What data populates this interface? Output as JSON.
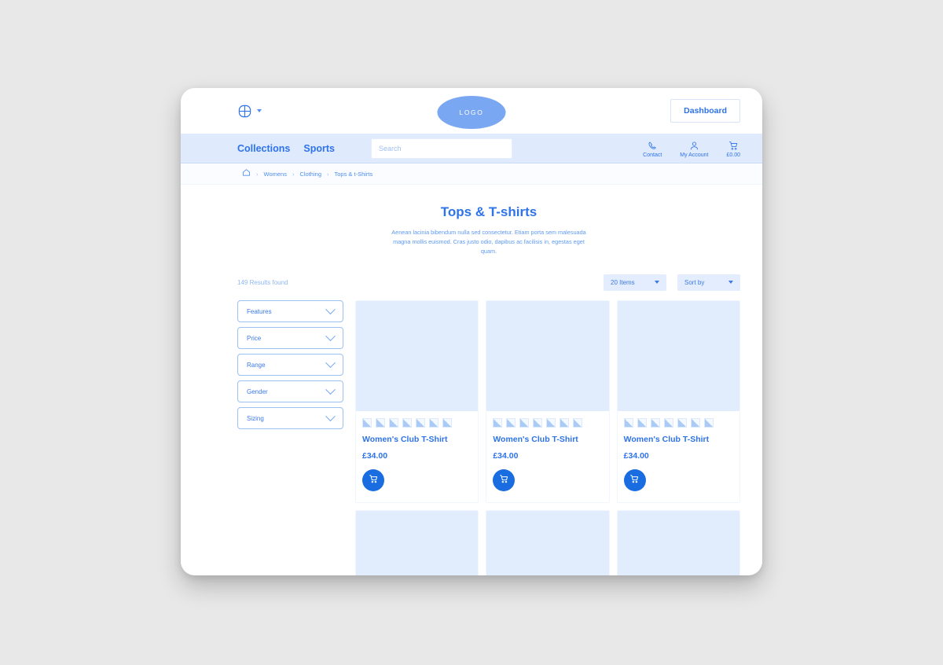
{
  "header": {
    "language_icon": "globe-icon",
    "language_caret": "caret-down-icon",
    "logo_text": "LOGO",
    "dashboard_label": "Dashboard"
  },
  "nav": {
    "links": [
      {
        "label": "Collections"
      },
      {
        "label": "Sports"
      }
    ],
    "search": {
      "placeholder": "Search",
      "value": ""
    },
    "actions": [
      {
        "icon": "phone-icon",
        "label": "Contact"
      },
      {
        "icon": "user-icon",
        "label": "My Account"
      },
      {
        "icon": "cart-icon",
        "label": "£0.00"
      }
    ]
  },
  "breadcrumb": {
    "home_icon": "home-icon",
    "separator": "›",
    "items": [
      {
        "label": "Womens"
      },
      {
        "label": "Clothing"
      },
      {
        "label": "Tops & t-Shirts"
      }
    ]
  },
  "page": {
    "title": "Tops & T-shirts",
    "description": "Aenean lacinia bibendum nulla sed consectetur. Etiam porta sem malesuada magna mollis euismod. Cras justo odio, dapibus ac facilisis in, egestas eget quam."
  },
  "toolbar": {
    "results_count": "149 Results found",
    "items_per_page": "20 Items",
    "sort_by": "Sort by"
  },
  "filters": [
    {
      "label": "Features"
    },
    {
      "label": "Price"
    },
    {
      "label": "Range"
    },
    {
      "label": "Gender"
    },
    {
      "label": "Sizing"
    }
  ],
  "products": [
    {
      "title": "Women's Club T-Shirt",
      "price": "£34.00",
      "swatches": 7,
      "cart_icon": "cart-icon"
    },
    {
      "title": "Women's Club T-Shirt",
      "price": "£34.00",
      "swatches": 7,
      "cart_icon": "cart-icon"
    },
    {
      "title": "Women's Club T-Shirt",
      "price": "£34.00",
      "swatches": 7,
      "cart_icon": "cart-icon"
    }
  ],
  "products_row2": [
    {
      "title": "",
      "price": ""
    },
    {
      "title": "",
      "price": ""
    },
    {
      "title": "",
      "price": ""
    }
  ],
  "colors": {
    "accent_blue": "#2e73e8",
    "cart_button_blue": "#1a6de0",
    "nav_background": "#dfeafc",
    "image_placeholder": "#e1ecfd",
    "logo_fill": "#7aa7f2",
    "page_background": "#e8e8e8"
  }
}
